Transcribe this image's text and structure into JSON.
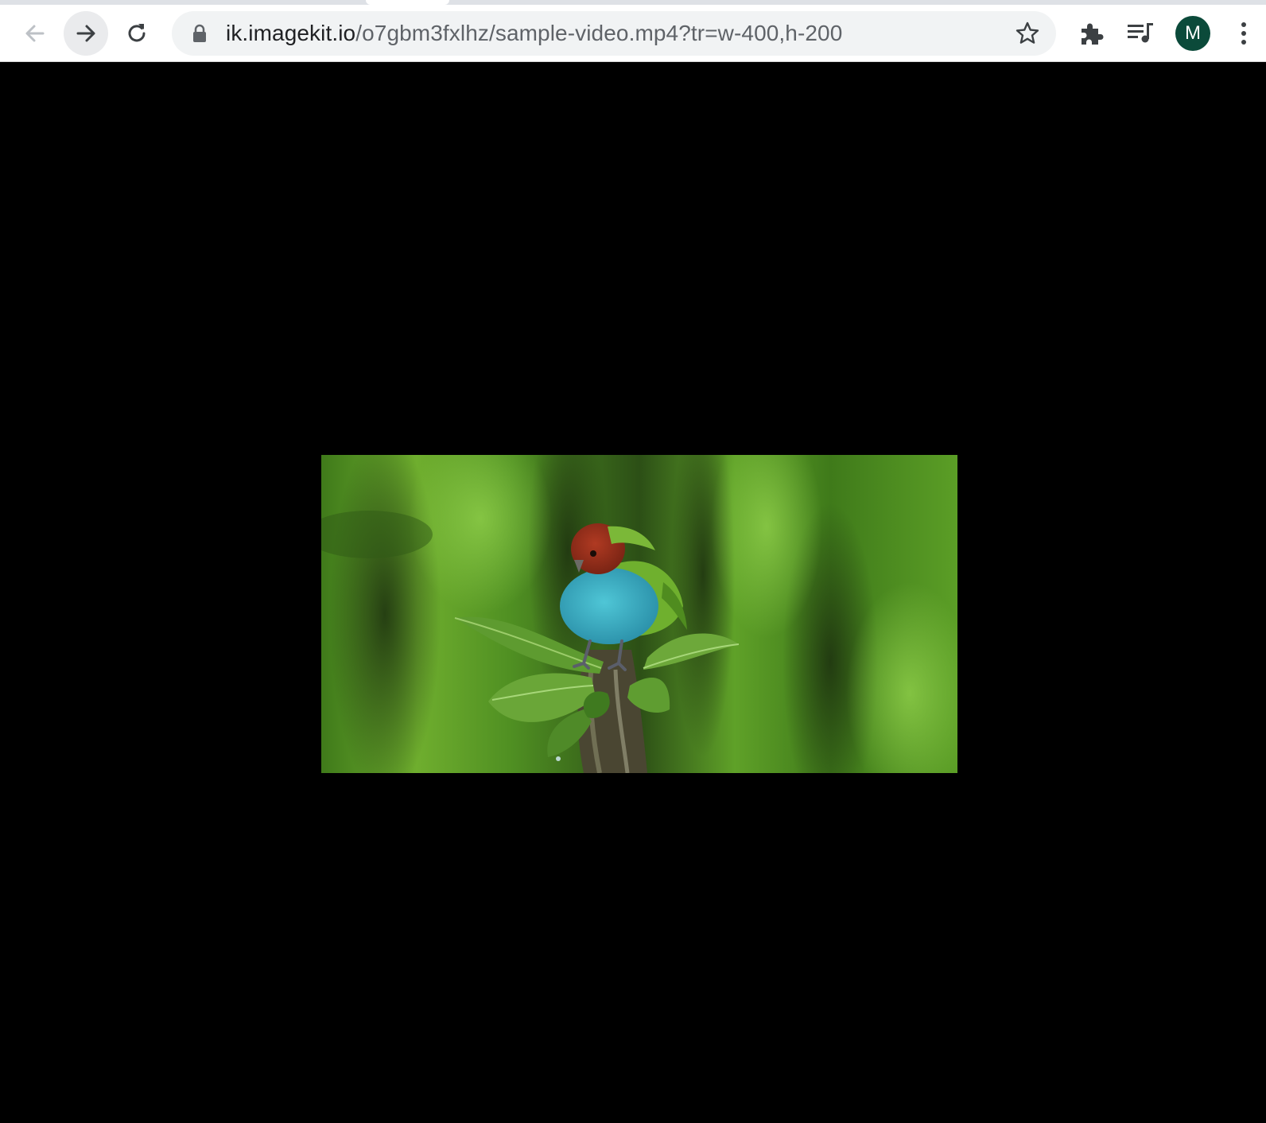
{
  "browser": {
    "url_host": "ik.imagekit.io",
    "url_path": "/o7gbm3fxlhz/sample-video.mp4?tr=w-400,h-200",
    "profile_initial": "M",
    "colors": {
      "toolbar_bg": "#ffffff",
      "omnibox_bg": "#f1f3f4",
      "avatar_bg": "#0b4a3a",
      "page_bg": "#000000"
    },
    "icons": {
      "back": "arrow-left-icon",
      "forward": "arrow-right-icon",
      "reload": "reload-icon",
      "lock": "lock-icon",
      "bookmark": "star-icon",
      "extensions": "puzzle-icon",
      "media": "media-playlist-icon",
      "menu": "kebab-menu-icon"
    }
  },
  "video": {
    "subject": "bird-on-branch-frame"
  }
}
